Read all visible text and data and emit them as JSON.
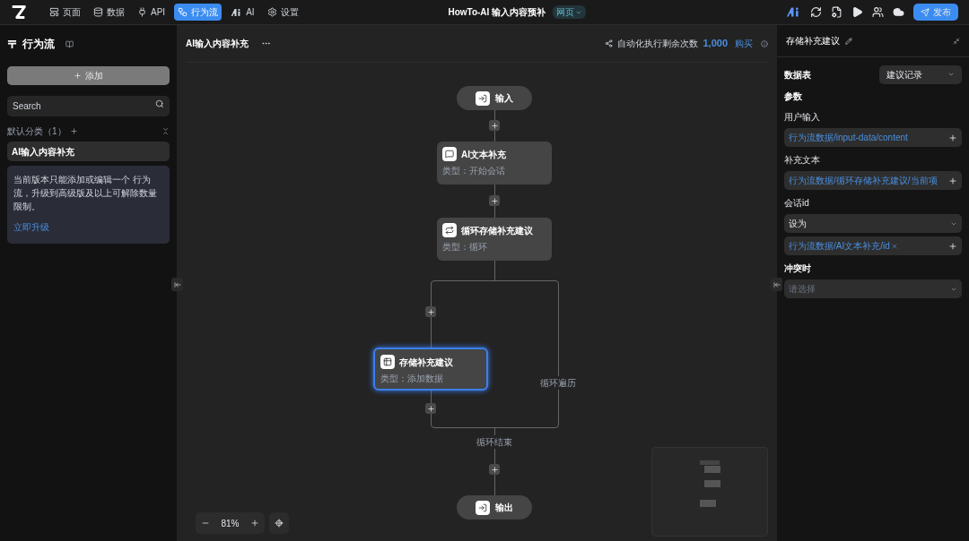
{
  "topbar": {
    "nav": [
      {
        "label": "页面",
        "selected": false
      },
      {
        "label": "数据",
        "selected": false
      },
      {
        "label": "API",
        "selected": false
      },
      {
        "label": "行为流",
        "selected": true
      },
      {
        "label": "AI",
        "selected": false
      },
      {
        "label": "设置",
        "selected": false
      }
    ],
    "title": "HowTo-AI 输入内容预补",
    "badge": "网页",
    "publish": "发布"
  },
  "sidebar": {
    "title": "行为流",
    "add": "添加",
    "search": {
      "placeholder": "Search"
    },
    "category": "默认分类（1）",
    "items": [
      {
        "label": "AI输入内容补充",
        "selected": true
      }
    ],
    "notice": "当前版本只能添加或编辑一个 行为流，升级到高级版及以上可解除数量限制。",
    "upgrade": "立即升级"
  },
  "canvas": {
    "title": "AI输入内容补充",
    "quota_label": "自动化执行剩余次数",
    "quota": "1,000",
    "buy": "购买",
    "nodes": [
      {
        "kind": "terminal",
        "label": "输入",
        "selected": false
      },
      {
        "kind": "step",
        "label": "AI文本补充",
        "type": "类型：开始会话",
        "selected": false
      },
      {
        "kind": "step",
        "label": "循环存储补充建议",
        "type": "类型：循环",
        "selected": false
      },
      {
        "kind": "step",
        "label": "存储补充建议",
        "type": "类型：添加数据",
        "selected": true
      },
      {
        "kind": "terminal",
        "label": "输出",
        "selected": false
      }
    ],
    "edge_labels": [
      "循环遍历",
      "循环结束"
    ],
    "zoom": "81%"
  },
  "panel": {
    "title": "存储补充建议",
    "table_label": "数据表",
    "table_value": "建议记录",
    "section": "参数",
    "rows": [
      {
        "kind": "label",
        "text": "用户输入"
      },
      {
        "kind": "path",
        "text": "行为流数据/input-data/content"
      },
      {
        "kind": "label",
        "text": "补充文本"
      },
      {
        "kind": "path",
        "text": "行为流数据/循环存储补充建议/当前项"
      },
      {
        "kind": "label",
        "text": "会话id"
      },
      {
        "kind": "select",
        "text": "设为"
      },
      {
        "kind": "path-clear",
        "text": "行为流数据/AI文本补充/id"
      },
      {
        "kind": "heading",
        "text": "冲突时"
      },
      {
        "kind": "placeholder",
        "text": "请选择"
      }
    ]
  }
}
